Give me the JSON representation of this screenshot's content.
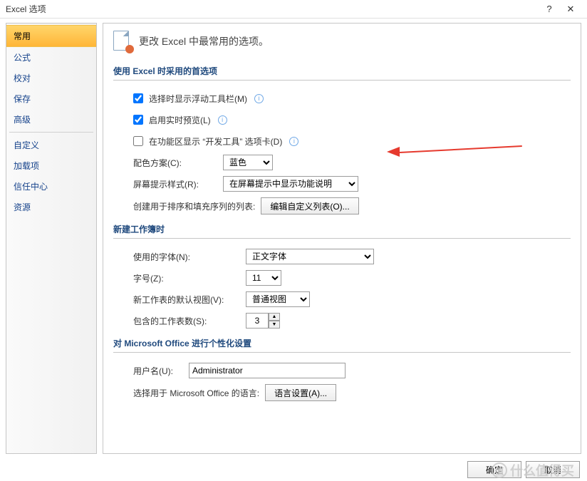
{
  "window": {
    "title": "Excel 选项",
    "help": "?",
    "close": "✕"
  },
  "sidebar": {
    "items": [
      {
        "label": "常用",
        "active": true
      },
      {
        "label": "公式"
      },
      {
        "label": "校对"
      },
      {
        "label": "保存"
      },
      {
        "label": "高级"
      },
      {
        "sep": true
      },
      {
        "label": "自定义"
      },
      {
        "label": "加载项"
      },
      {
        "label": "信任中心"
      },
      {
        "label": "资源"
      }
    ]
  },
  "header": "更改 Excel 中最常用的选项。",
  "section1": {
    "title": "使用 Excel 时采用的首选项",
    "cb1": "选择时显示浮动工具栏(M)",
    "cb2": "启用实时预览(L)",
    "cb3": "在功能区显示 “开发工具” 选项卡(D)",
    "colorLabel": "配色方案(C):",
    "colorValue": "蓝色",
    "tipLabel": "屏幕提示样式(R):",
    "tipValue": "在屏幕提示中显示功能说明",
    "sortLabel": "创建用于排序和填充序列的列表:",
    "sortBtn": "编辑自定义列表(O)..."
  },
  "section2": {
    "title": "新建工作簿时",
    "fontLabel": "使用的字体(N):",
    "fontValue": "正文字体",
    "sizeLabel": "字号(Z):",
    "sizeValue": "11",
    "viewLabel": "新工作表的默认视图(V):",
    "viewValue": "普通视图",
    "countLabel": "包含的工作表数(S):",
    "countValue": "3"
  },
  "section3": {
    "title": "对 Microsoft Office 进行个性化设置",
    "userLabel": "用户名(U):",
    "userValue": "Administrator",
    "langLabel": "选择用于 Microsoft Office 的语言:",
    "langBtn": "语言设置(A)..."
  },
  "footer": {
    "ok": "确定",
    "cancel": "取消"
  },
  "watermark": "什么值得买"
}
